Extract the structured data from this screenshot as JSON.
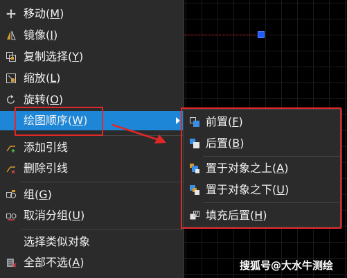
{
  "main_menu": {
    "items": [
      {
        "text": "移动(",
        "key": "M",
        "close": ")",
        "icon": "move-icon"
      },
      {
        "text": "镜像(",
        "key": "I",
        "close": ")",
        "icon": "mirror-icon"
      },
      {
        "text": "复制选择(",
        "key": "Y",
        "close": ")",
        "icon": "copy-selection-icon"
      },
      {
        "text": "缩放(",
        "key": "L",
        "close": ")",
        "icon": "scale-icon"
      },
      {
        "text": "旋转(",
        "key": "O",
        "close": ")",
        "icon": "rotate-icon"
      },
      {
        "text": "绘图顺序(",
        "key": "W",
        "close": ")",
        "icon": "",
        "selected": true,
        "has_submenu": true
      },
      {
        "text": "添加引线",
        "key": "",
        "close": "",
        "icon": "add-leader-icon"
      },
      {
        "text": "删除引线",
        "key": "",
        "close": "",
        "icon": "remove-leader-icon"
      },
      {
        "text": "组(",
        "key": "G",
        "close": ")",
        "icon": "group-icon"
      },
      {
        "text": "取消分组(",
        "key": "U",
        "close": ")",
        "icon": "ungroup-icon"
      },
      {
        "text": "选择类似对象",
        "key": "",
        "close": "",
        "icon": ""
      },
      {
        "text": "全部不选(",
        "key": "A",
        "close": ")",
        "icon": "deselect-all-icon"
      }
    ]
  },
  "submenu": {
    "items": [
      {
        "text": "前置(",
        "key": "F",
        "close": ")",
        "icon": "bring-to-front-icon"
      },
      {
        "text": "后置(",
        "key": "B",
        "close": ")",
        "icon": "send-to-back-icon"
      },
      {
        "text": "置于对象之上(",
        "key": "A",
        "close": ")",
        "icon": "bring-above-object-icon"
      },
      {
        "text": "置于对象之下(",
        "key": "U",
        "close": ")",
        "icon": "send-under-object-icon"
      },
      {
        "text": "填充后置(",
        "key": "H",
        "close": ")",
        "icon": "hatch-to-back-icon"
      }
    ]
  },
  "watermark": "搜狐号@大水牛测绘",
  "colors": {
    "highlight": "#1e86d6",
    "annotation": "#e12828",
    "grip": "#1f5cff"
  }
}
